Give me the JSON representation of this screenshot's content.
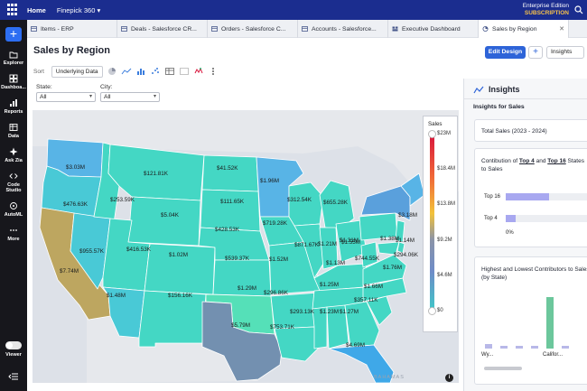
{
  "topbar": {
    "home": "Home",
    "workspace": "Finepick 360",
    "workspace_caret": "▾",
    "edition": "Enterprise Edition",
    "subscription": "SUBSCRIPTION"
  },
  "rail": {
    "items": [
      {
        "label": "Explorer",
        "icon": "folder-icon"
      },
      {
        "label": "Dashboa...",
        "icon": "dashboard-icon"
      },
      {
        "label": "Reports",
        "icon": "reports-icon"
      },
      {
        "label": "Data",
        "icon": "data-icon"
      },
      {
        "label": "Ask Zia",
        "icon": "ask-zia-icon"
      },
      {
        "label": "Code Studio",
        "icon": "code-studio-icon"
      },
      {
        "label": "AutoML",
        "icon": "automl-icon"
      },
      {
        "label": "More",
        "icon": "more-icon"
      }
    ],
    "viewer": "Viewer"
  },
  "tabs": [
    {
      "label": "Items - ERP",
      "icon": "table-icon",
      "color": "#4a5a8c"
    },
    {
      "label": "Deals - Salesforce CR...",
      "icon": "table-icon",
      "color": "#4a5a8c"
    },
    {
      "label": "Orders - Salesforce C...",
      "icon": "table-icon",
      "color": "#4a5a8c"
    },
    {
      "label": "Accounts - Salesforce...",
      "icon": "table-icon",
      "color": "#4a5a8c"
    },
    {
      "label": "Executive Dashboard",
      "icon": "dashboard-icon",
      "color": "#4a5a8c"
    },
    {
      "label": "Sales by Region",
      "icon": "chart-icon",
      "color": "#4a5a8c"
    }
  ],
  "view": {
    "title": "Sales by Region",
    "edit_design": "Edit Design",
    "add": "+",
    "insights_btn": "Insights"
  },
  "toolbar": {
    "sort": "Sort",
    "underlying": "Underlying Data"
  },
  "filters": {
    "state_label": "State:",
    "state_value": "All",
    "city_label": "City:",
    "city_value": "All"
  },
  "map": {
    "bahamas": "BAHAMAS",
    "legend": {
      "title": "Sales",
      "ticks": [
        "$23M",
        "$18.4M",
        "$13.8M",
        "$9.2M",
        "$4.6M",
        "$0"
      ],
      "colors": [
        "#d8153c",
        "#f06a38",
        "#f2c23a",
        "#8b94a8",
        "#6e8cc8",
        "#3fc7c8"
      ]
    },
    "labels": [
      {
        "state": "WA",
        "text": "$3.03M"
      },
      {
        "state": "OR",
        "text": "$476.63K"
      },
      {
        "state": "CA",
        "text": "$7.74M"
      },
      {
        "state": "NV",
        "text": "$955.57K"
      },
      {
        "state": "ID",
        "text": "$253.59K"
      },
      {
        "state": "MT",
        "text": "$121.81K"
      },
      {
        "state": "WY",
        "text": "$5.04K"
      },
      {
        "state": "UT",
        "text": "$416.53K"
      },
      {
        "state": "AZ",
        "text": "$1.48M"
      },
      {
        "state": "CO",
        "text": "$1.02M"
      },
      {
        "state": "NM",
        "text": "$156.16K"
      },
      {
        "state": "ND",
        "text": "$41.52K"
      },
      {
        "state": "SD",
        "text": "$111.65K"
      },
      {
        "state": "NE",
        "text": "$428.53K"
      },
      {
        "state": "KS",
        "text": "$539.37K"
      },
      {
        "state": "OK",
        "text": "$1.29M"
      },
      {
        "state": "TX",
        "text": "$5.79M"
      },
      {
        "state": "MN",
        "text": "$1.96M"
      },
      {
        "state": "IA",
        "text": "$719.28K"
      },
      {
        "state": "MO",
        "text": "$1.52M"
      },
      {
        "state": "AR",
        "text": "$296.86K"
      },
      {
        "state": "LA",
        "text": "$753.71K"
      },
      {
        "state": "WI",
        "text": "$312.54K"
      },
      {
        "state": "MI",
        "text": "$655.28K"
      },
      {
        "state": "IL",
        "text": "$871.67K"
      },
      {
        "state": "IN",
        "text": "$1.21M"
      },
      {
        "state": "OH",
        "text": "$1.55M"
      },
      {
        "state": "KY",
        "text": "$1.13M"
      },
      {
        "state": "TN",
        "text": "$1.25M"
      },
      {
        "state": "MS",
        "text": "$293.13K"
      },
      {
        "state": "AL",
        "text": "$1.23M"
      },
      {
        "state": "GA",
        "text": "$1.27M"
      },
      {
        "state": "FL",
        "text": "$4.69M"
      },
      {
        "state": "SC",
        "text": "$357.11K"
      },
      {
        "state": "NC",
        "text": "$1.66M"
      },
      {
        "state": "VA",
        "text": "$744.55K"
      },
      {
        "state": "WV",
        "text": "$1.31M"
      },
      {
        "state": "PA",
        "text": "$1.38M"
      },
      {
        "state": "NY",
        "text": "$3.18M"
      },
      {
        "state": "NJ",
        "text": "$1.14M"
      },
      {
        "state": "MD",
        "text": "$294.06K"
      },
      {
        "state": "DE",
        "text": "$1.76M"
      }
    ]
  },
  "insights": {
    "title": "Insights",
    "for_sales": "Insights for Sales",
    "total_label": "Total Sales (2023 - 2024)",
    "contrib_prefix": "Contibution of ",
    "contrib_top4": "Top 4",
    "contrib_mid": " and ",
    "contrib_top16": "Top 16",
    "contrib_suffix": " States to Sales",
    "rows": [
      {
        "label": "Top 16",
        "value": 0.85
      },
      {
        "label": "Top 4",
        "value": 0.2
      }
    ],
    "zero": "0%",
    "hl_title": "Highest and Lowest Contributors to Sales (by State)",
    "hl_bars": [
      {
        "label": "Wy...",
        "value": 0.08,
        "color": "#b8b8e8"
      },
      {
        "label": "",
        "value": 0.03,
        "color": "#b8b8e8"
      },
      {
        "label": "",
        "value": 0.05,
        "color": "#b8b8e8"
      },
      {
        "label": "",
        "value": 0.04,
        "color": "#b8b8e8"
      },
      {
        "label": "Califor...",
        "value": 1.0,
        "color": "#6cc79c"
      },
      {
        "label": "",
        "value": 0.06,
        "color": "#b8b8e8"
      }
    ]
  }
}
